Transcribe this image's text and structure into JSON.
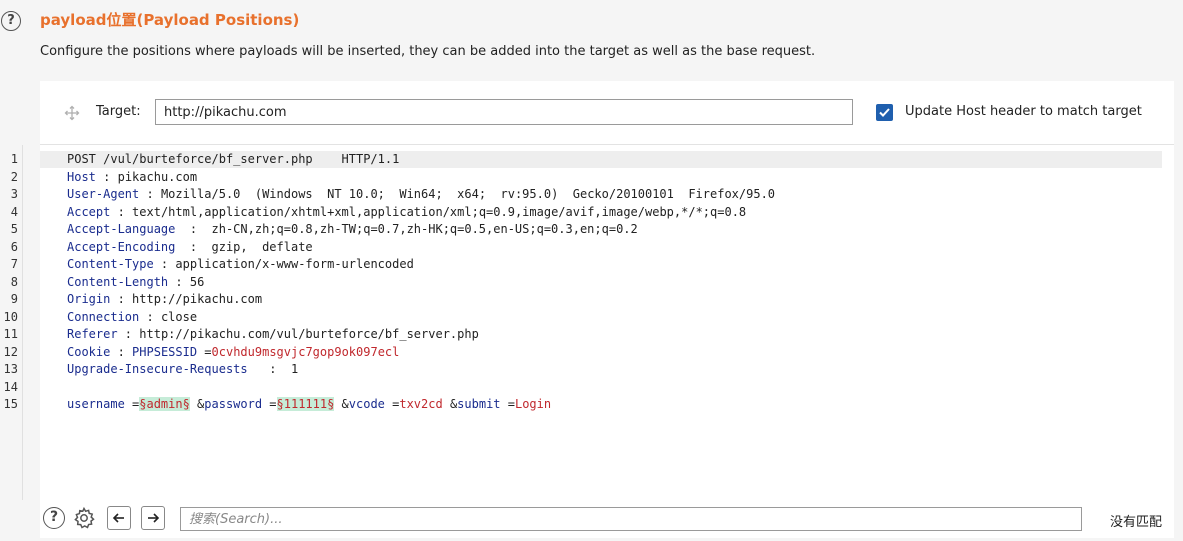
{
  "header": {
    "title": "payload位置(Payload Positions)",
    "description": "Configure the positions where payloads will be inserted, they can be added into the target as well as the base request."
  },
  "target": {
    "label": "Target:",
    "value": "http://pikachu.com",
    "update_host_label": "Update Host header to match target",
    "update_host_checked": true
  },
  "request": {
    "line_numbers": [
      "1",
      "2",
      "3",
      "4",
      "5",
      "6",
      "7",
      "8",
      "9",
      "10",
      "11",
      "12",
      "13",
      "14",
      "15"
    ],
    "request_line": "POST /vul/burteforce/bf_server.php    HTTP/1.1",
    "headers": [
      {
        "name": "Host",
        "sep": " : ",
        "value": "pikachu.com"
      },
      {
        "name": "User-Agent",
        "sep": " : ",
        "value": "Mozilla/5.0  (Windows  NT 10.0;  Win64;  x64;  rv:95.0)  Gecko/20100101  Firefox/95.0"
      },
      {
        "name": "Accept",
        "sep": " : ",
        "value": "text/html,application/xhtml+xml,application/xml;q=0.9,image/avif,image/webp,*/*;q=0.8"
      },
      {
        "name": "Accept-Language",
        "sep": "  :  ",
        "value": "zh-CN,zh;q=0.8,zh-TW;q=0.7,zh-HK;q=0.5,en-US;q=0.3,en;q=0.2"
      },
      {
        "name": "Accept-Encoding",
        "sep": "  :  ",
        "value": "gzip,  deflate"
      },
      {
        "name": "Content-Type",
        "sep": " : ",
        "value": "application/x-www-form-urlencoded"
      },
      {
        "name": "Content-Length",
        "sep": " : ",
        "value": "56"
      },
      {
        "name": "Origin",
        "sep": " : ",
        "value": "http://pikachu.com"
      },
      {
        "name": "Connection",
        "sep": " : ",
        "value": "close"
      },
      {
        "name": "Referer",
        "sep": " : ",
        "value": "http://pikachu.com/vul/burteforce/bf_server.php"
      }
    ],
    "cookie": {
      "name": "Cookie",
      "sep": " : ",
      "key": "PHPSESSID",
      "eq": " =",
      "value": "0cvhdu9msgvjc7gop9ok097ecl"
    },
    "upgrade": {
      "name": "Upgrade-Insecure-Requests",
      "sep": "   :  ",
      "value": "1"
    },
    "body": {
      "p1_name": "username",
      "p1_eq": " =",
      "p1_value": "§admin§",
      "amp1": " &",
      "p2_name": "password",
      "p2_eq": " =",
      "p2_value": "§111111§",
      "amp2": " &",
      "p3_name": "vcode",
      "p3_eq": " =",
      "p3_value": "txv2cd",
      "amp3": " &",
      "p4_name": "submit",
      "p4_eq": " =",
      "p4_value": "Login"
    }
  },
  "footer": {
    "search_placeholder": "搜索(Search)...",
    "no_match": "没有匹配"
  },
  "icons": [
    "help-icon",
    "move-icon",
    "checkmark-icon",
    "settings-gear-icon",
    "arrow-left-icon",
    "arrow-right-icon"
  ]
}
